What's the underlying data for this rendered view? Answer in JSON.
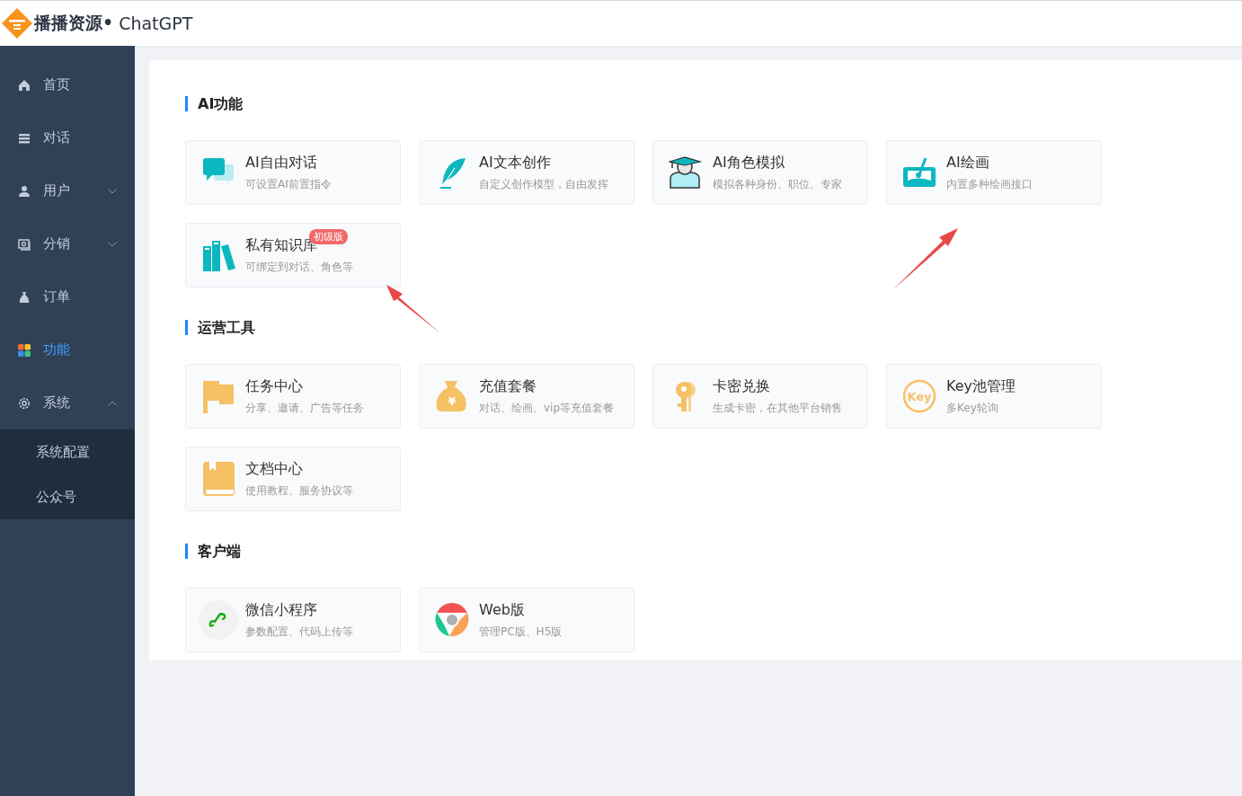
{
  "header": {
    "brand": "播播资源•",
    "app": "ChatGPT"
  },
  "sidebar": {
    "items": [
      {
        "label": "首页",
        "kind": "home",
        "selected": false
      },
      {
        "label": "对话",
        "kind": "list",
        "selected": false
      },
      {
        "label": "用户",
        "kind": "user",
        "selected": false,
        "expanded": false
      },
      {
        "label": "分销",
        "kind": "wallet",
        "selected": false,
        "expanded": false
      },
      {
        "label": "订单",
        "kind": "bag",
        "selected": false
      },
      {
        "label": "功能",
        "kind": "grid",
        "selected": true
      },
      {
        "label": "系统",
        "kind": "gear",
        "selected": false,
        "expanded": true,
        "children": [
          {
            "label": "系统配置",
            "selected": false
          },
          {
            "label": "公众号",
            "selected": false
          }
        ]
      }
    ]
  },
  "sections": [
    {
      "title": "AI功能",
      "cards": [
        {
          "kind": "chat",
          "title": "AI自由对话",
          "desc": "可设置AI前置指令"
        },
        {
          "kind": "feather",
          "title": "AI文本创作",
          "desc": "自定义创作模型，自由发挥"
        },
        {
          "kind": "graduate",
          "title": "AI角色模拟",
          "desc": "模拟各种身份、职位、专家"
        },
        {
          "kind": "paint",
          "title": "AI绘画",
          "desc": "内置多种绘画接口"
        },
        {
          "kind": "books",
          "title": "私有知识库",
          "desc": "可绑定到对话、角色等",
          "badge": "初级版"
        }
      ]
    },
    {
      "title": "运营工具",
      "cards": [
        {
          "kind": "flag",
          "title": "任务中心",
          "desc": "分享、邀请、广告等任务"
        },
        {
          "kind": "moneybag",
          "icon_text": "¥",
          "title": "充值套餐",
          "desc": "对话、绘画、vip等充值套餐"
        },
        {
          "kind": "key",
          "title": "卡密兑换",
          "desc": "生成卡密，在其他平台销售"
        },
        {
          "kind": "keycircle",
          "icon_text": "Key",
          "title": "Key池管理",
          "desc": "多Key轮询"
        },
        {
          "kind": "book",
          "title": "文档中心",
          "desc": "使用教程、服务协议等"
        }
      ]
    },
    {
      "title": "客户端",
      "cards": [
        {
          "kind": "miniprogram",
          "title": "微信小程序",
          "desc": "参数配置、代码上传等"
        },
        {
          "kind": "browser",
          "title": "Web版",
          "desc": "管理PC版、H5版"
        }
      ]
    }
  ]
}
